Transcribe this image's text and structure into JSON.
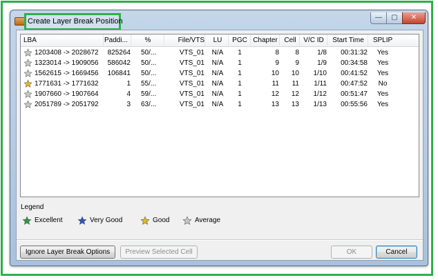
{
  "window": {
    "title": "Create Layer Break Position",
    "controls": {
      "minimize": "—",
      "maximize": "▢",
      "close": "✕"
    }
  },
  "table": {
    "columns": [
      "LBA",
      "Paddi...",
      "%",
      "File/VTS",
      "LU",
      "PGC",
      "Chapter",
      "Cell",
      "V/C ID",
      "Start Time",
      "SPLIP"
    ],
    "rows": [
      {
        "rating": "average",
        "lba": "1203408 -> 2028672",
        "padding": "825264",
        "pct": "50/...",
        "file": "VTS_01",
        "lu": "N/A",
        "pgc": "1",
        "chapter": "8",
        "cell": "8",
        "vcid": "1/8",
        "start": "00:31:32",
        "splip": "Yes"
      },
      {
        "rating": "average",
        "lba": "1323014 -> 1909056",
        "padding": "586042",
        "pct": "50/...",
        "file": "VTS_01",
        "lu": "N/A",
        "pgc": "1",
        "chapter": "9",
        "cell": "9",
        "vcid": "1/9",
        "start": "00:34:58",
        "splip": "Yes"
      },
      {
        "rating": "average",
        "lba": "1562615 -> 1669456",
        "padding": "106841",
        "pct": "50/...",
        "file": "VTS_01",
        "lu": "N/A",
        "pgc": "1",
        "chapter": "10",
        "cell": "10",
        "vcid": "1/10",
        "start": "00:41:52",
        "splip": "Yes"
      },
      {
        "rating": "good",
        "lba": "1771631 -> 1771632",
        "padding": "1",
        "pct": "55/...",
        "file": "VTS_01",
        "lu": "N/A",
        "pgc": "1",
        "chapter": "11",
        "cell": "11",
        "vcid": "1/11",
        "start": "00:47:52",
        "splip": "No"
      },
      {
        "rating": "average",
        "lba": "1907660 -> 1907664",
        "padding": "4",
        "pct": "59/...",
        "file": "VTS_01",
        "lu": "N/A",
        "pgc": "1",
        "chapter": "12",
        "cell": "12",
        "vcid": "1/12",
        "start": "00:51:47",
        "splip": "Yes"
      },
      {
        "rating": "average",
        "lba": "2051789 -> 2051792",
        "padding": "3",
        "pct": "63/...",
        "file": "VTS_01",
        "lu": "N/A",
        "pgc": "1",
        "chapter": "13",
        "cell": "13",
        "vcid": "1/13",
        "start": "00:55:56",
        "splip": "Yes"
      }
    ]
  },
  "legend": {
    "title": "Legend",
    "items": [
      {
        "key": "excellent",
        "label": "Excellent",
        "color": "#2e9b3a"
      },
      {
        "key": "very_good",
        "label": "Very Good",
        "color": "#2a55c4"
      },
      {
        "key": "good",
        "label": "Good",
        "color": "#e7b81c"
      },
      {
        "key": "average",
        "label": "Average",
        "color": "#c8c8c8"
      }
    ]
  },
  "buttons": {
    "ignore": "Ignore Layer Break Options",
    "preview": "Preview Selected Cell",
    "ok": "OK",
    "cancel": "Cancel"
  },
  "colors": {
    "highlight_border": "#2fae4a",
    "star_excellent": "#2e9b3a",
    "star_very_good": "#2a55c4",
    "star_good": "#e7b81c",
    "star_average": "#c8c8c8"
  },
  "icons": {
    "row_rating": "star-icon",
    "app": "app-icon"
  }
}
